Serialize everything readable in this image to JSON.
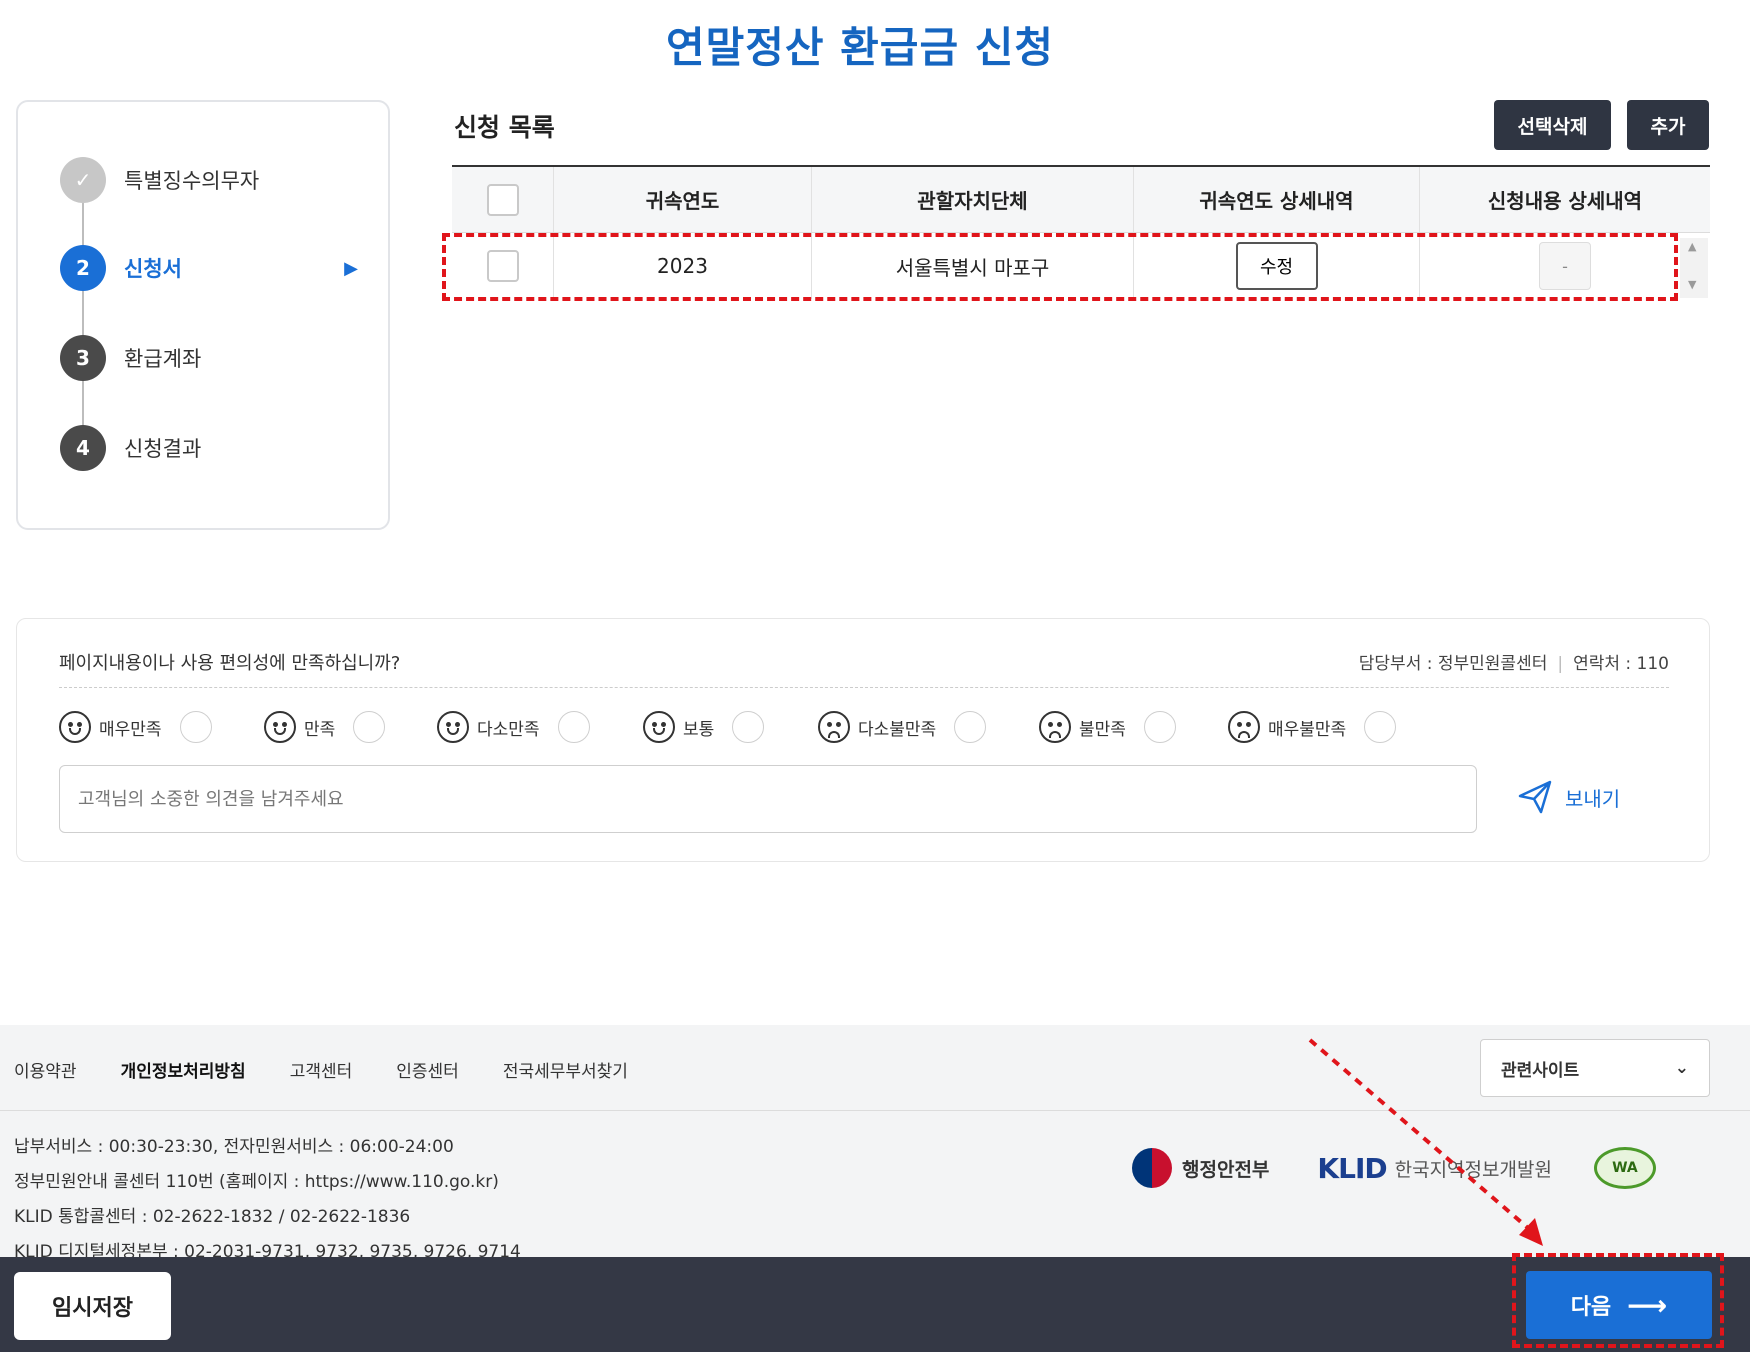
{
  "page": {
    "title": "연말정산 환급금 신청"
  },
  "steps": [
    {
      "number": "✓",
      "label": "특별징수의무자",
      "state": "done"
    },
    {
      "number": "2",
      "label": "신청서",
      "state": "active"
    },
    {
      "number": "3",
      "label": "환급계좌",
      "state": "todo"
    },
    {
      "number": "4",
      "label": "신청결과",
      "state": "todo"
    }
  ],
  "list": {
    "title": "신청 목록",
    "delete_label": "선택삭제",
    "add_label": "추가",
    "columns": [
      "귀속연도",
      "관할자치단체",
      "귀속연도 상세내역",
      "신청내용 상세내역"
    ],
    "rows": [
      {
        "year": "2023",
        "region": "서울특별시 마포구",
        "edit_label": "수정",
        "detail_label": "-"
      }
    ]
  },
  "feedback": {
    "question": "페이지내용이나 사용 편의성에 만족하십니까?",
    "dept": "담당부서 : 정부민원콜센터",
    "contact": "연락처 : 110",
    "ratings": [
      "매우만족",
      "만족",
      "다소만족",
      "보통",
      "다소불만족",
      "불만족",
      "매우불만족"
    ],
    "placeholder": "고객님의 소중한 의견을 남겨주세요",
    "send_label": "보내기"
  },
  "footer": {
    "links": [
      "이용약관",
      "개인정보처리방침",
      "고객센터",
      "인증센터",
      "전국세무부서찾기"
    ],
    "related_label": "관련사이트",
    "info": [
      "납부서비스 : 00:30-23:30, 전자민원서비스 : 06:00-24:00",
      "정부민원안내 콜센터 110번 (홈페이지 : https://www.110.go.kr)",
      "KLID 통합콜센터 : 02-2622-1832 / 02-2622-1836",
      "KLID 디지털세정본부 : 02-2031-9731, 9732, 9735, 9726, 9714"
    ],
    "logo_mois": "행정안전부",
    "logo_klid": "KLID",
    "logo_klid_sub": "한국지역정보개발원",
    "logo_wa": "WA"
  },
  "bottom": {
    "temp_save_label": "임시저장",
    "next_label": "다음"
  },
  "colors": {
    "accent": "#1a6fd6",
    "title": "#1565c0",
    "dark": "#343845",
    "annotation": "#e0151b"
  }
}
